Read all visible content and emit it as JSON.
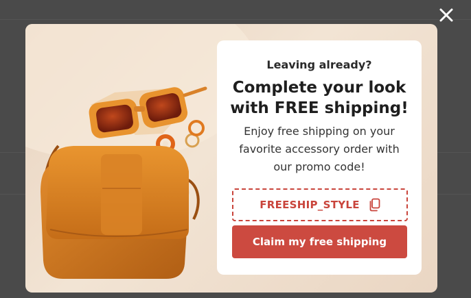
{
  "popup": {
    "close_icon": "close-icon",
    "kicker": "Leaving already?",
    "headline": "Complete your look with FREE shipping!",
    "body": "Enjoy free shipping on your favorite accessory order with our promo code!",
    "promo_code": "FREESHIP_STYLE",
    "copy_icon": "copy-icon",
    "cta_label": "Claim my free shipping"
  },
  "colors": {
    "accent": "#cc4a40",
    "overlay": "#4a4a4a",
    "photo_background": "#efdfcd"
  }
}
